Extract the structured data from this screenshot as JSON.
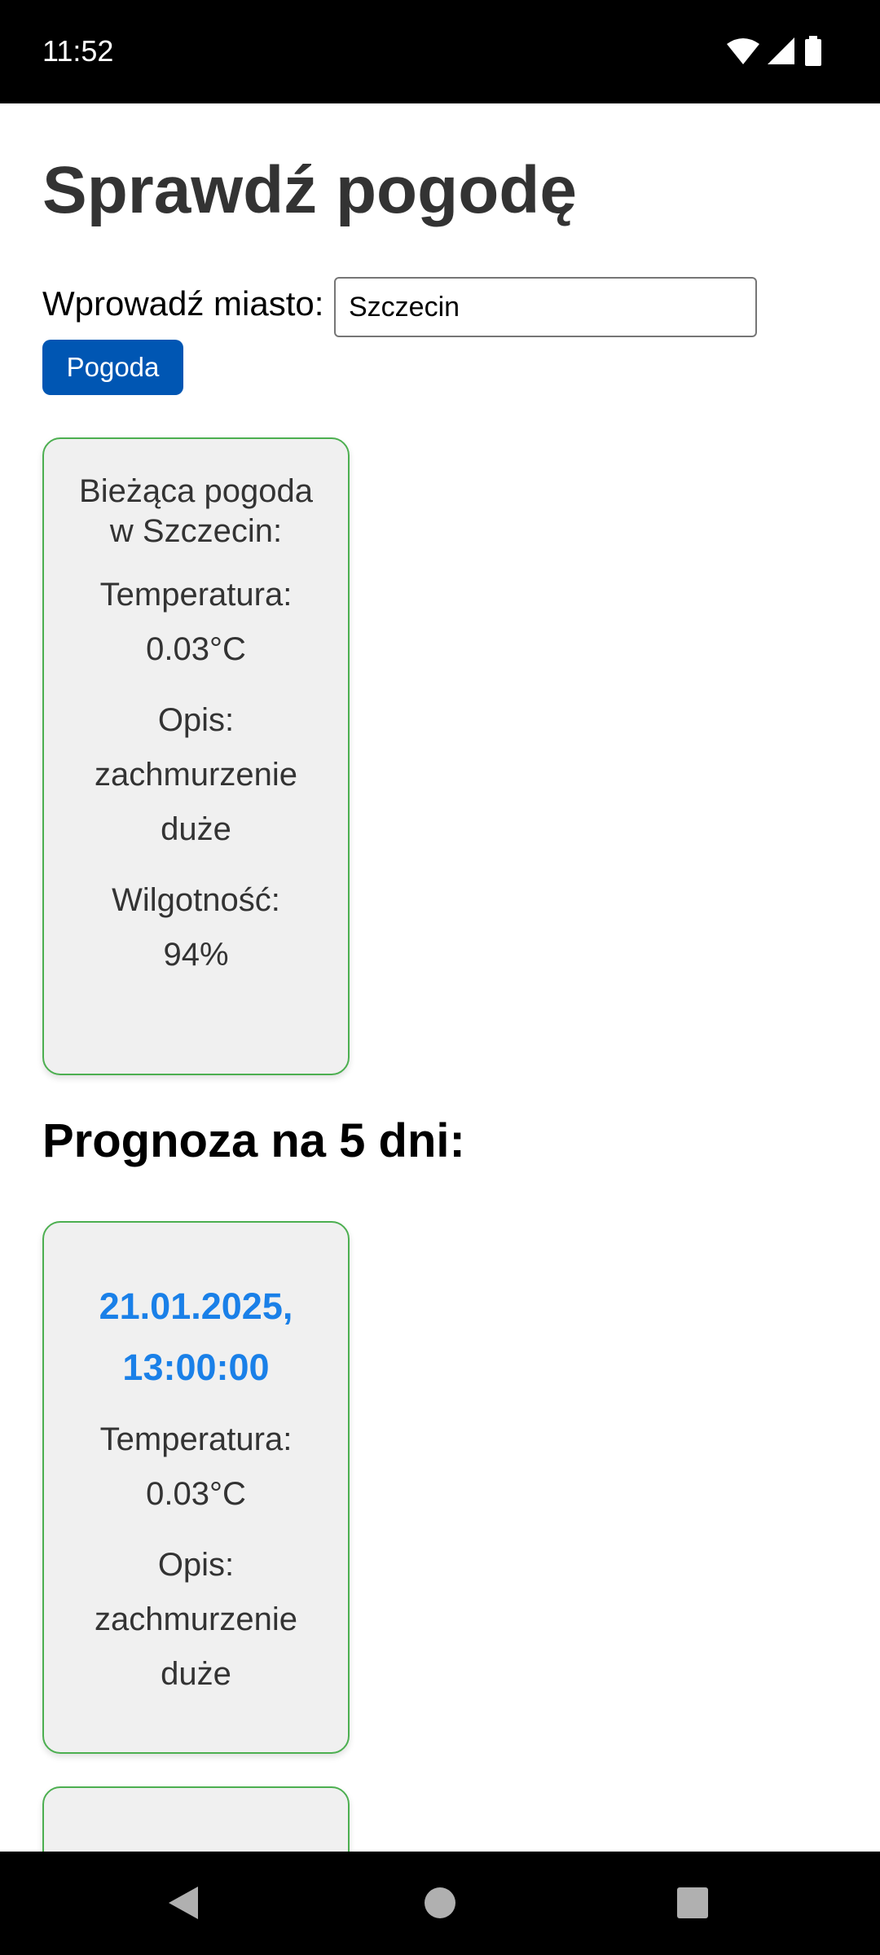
{
  "status_bar": {
    "time": "11:52",
    "icons": [
      "wifi-icon",
      "signal-icon",
      "battery-icon"
    ]
  },
  "page": {
    "title": "Sprawdź pogodę"
  },
  "search": {
    "label": "Wprowadź miasto:",
    "value": "Szczecin",
    "button_label": "Pogoda"
  },
  "current_weather": {
    "heading": "Bieżąca pogoda w Szczecin:",
    "temperature": "Temperatura: 0.03°C",
    "description": "Opis: zachmurzenie duże",
    "humidity": "Wilgotność: 94%"
  },
  "forecast": {
    "title": "Prognoza na 5 dni:",
    "items": [
      {
        "datetime": "21.01.2025, 13:00:00",
        "temperature": "Temperatura: 0.03°C",
        "description": "Opis: zachmurzenie duże"
      }
    ]
  },
  "navigation": {
    "buttons": [
      "back-icon",
      "home-icon",
      "recents-icon"
    ]
  },
  "colors": {
    "primary_button": "#0056b3",
    "card_border": "#4caf50",
    "card_background": "#f0f0f0",
    "date_text": "#1a80e8"
  }
}
